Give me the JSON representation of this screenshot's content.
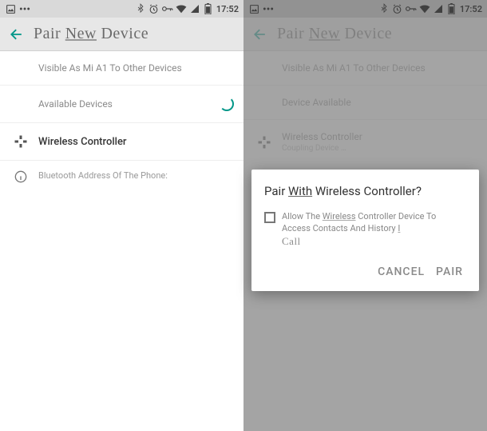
{
  "status": {
    "time": "17:52",
    "battery_icon": "battery",
    "battery_inner": "▮",
    "signal_icon": "signal",
    "wifi_icon": "wifi",
    "key_icon": "key",
    "alarm_icon": "alarm",
    "bt_icon": "bluetooth",
    "image_icon": "img",
    "more_icon": "more"
  },
  "left": {
    "title_pair": "Pair",
    "title_new": "New",
    "title_device": "Device",
    "visible_as": "Visible As Mi A1 To Other Devices",
    "available": "Available Devices",
    "device_name": "Wireless Controller",
    "bt_addr_label": "Bluetooth Address Of The Phone:"
  },
  "right": {
    "title_pair": "Pair",
    "title_new": "New",
    "title_device": "Device",
    "visible_as": "Visible As Mi A1 To Other Devices",
    "available": "Device Available",
    "device_name": "Wireless Controller",
    "device_sub": "Coupling Device …"
  },
  "dialog": {
    "title_pre": "Pair ",
    "title_with": "With",
    "title_rest": " Wireless Controller?",
    "consent_pre": "Allow The ",
    "consent_u": "Wireless",
    "consent_mid": " Controller Device To Access Contacts And History ",
    "consent_u2": "I",
    "call": "Call",
    "cancel": "CANCEL",
    "pair": "PAIR"
  }
}
